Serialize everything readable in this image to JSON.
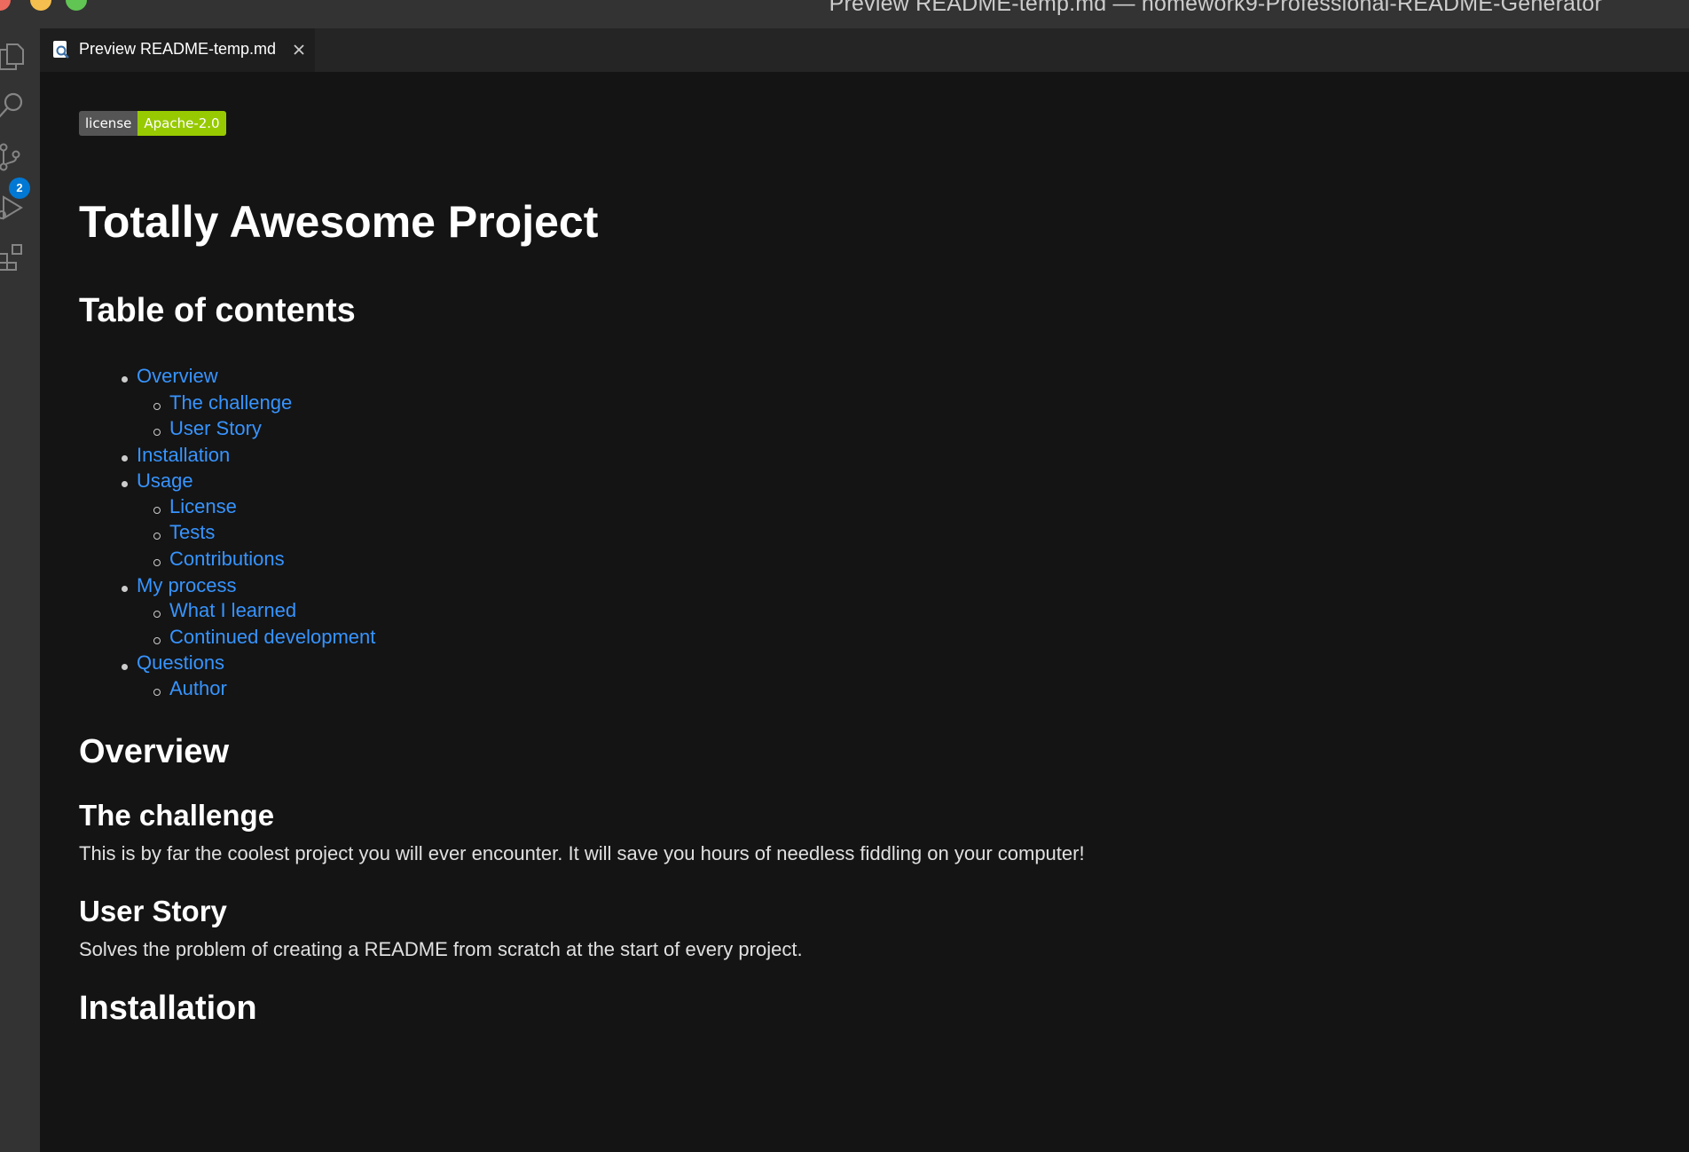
{
  "window": {
    "title": "Preview README-temp.md — homework9-Professional-README-Generator"
  },
  "activity_bar": {
    "icons": [
      "explorer-icon",
      "search-icon",
      "source-control-icon",
      "run-debug-icon",
      "extensions-icon"
    ],
    "source_control_badge": "2"
  },
  "tab": {
    "label": "Preview README-temp.md",
    "icon": "preview-icon",
    "close_icon": "close-icon"
  },
  "colors": {
    "link": "#3794ff",
    "badge_license_bg": "#555555",
    "badge_value_bg": "#97ca00",
    "background": "#141414"
  },
  "readme": {
    "license_badge": {
      "label": "license",
      "value": "Apache-2.0"
    },
    "title": "Totally Awesome Project",
    "toc_heading": "Table of contents",
    "toc": {
      "overview": "Overview",
      "the_challenge": "The challenge",
      "user_story": "User Story",
      "installation": "Installation",
      "usage": "Usage",
      "license": "License",
      "tests": "Tests",
      "contributions": "Contributions",
      "my_process": "My process",
      "what_i_learned": "What I learned",
      "continued_development": "Continued development",
      "questions": "Questions",
      "author": "Author"
    },
    "sections": {
      "overview_heading": "Overview",
      "challenge_heading": "The challenge",
      "challenge_text": "This is by far the coolest project you will ever encounter. It will save you hours of needless fiddling on your computer!",
      "user_story_heading": "User Story",
      "user_story_text": "Solves the problem of creating a README from scratch at the start of every project.",
      "installation_heading": "Installation"
    }
  }
}
